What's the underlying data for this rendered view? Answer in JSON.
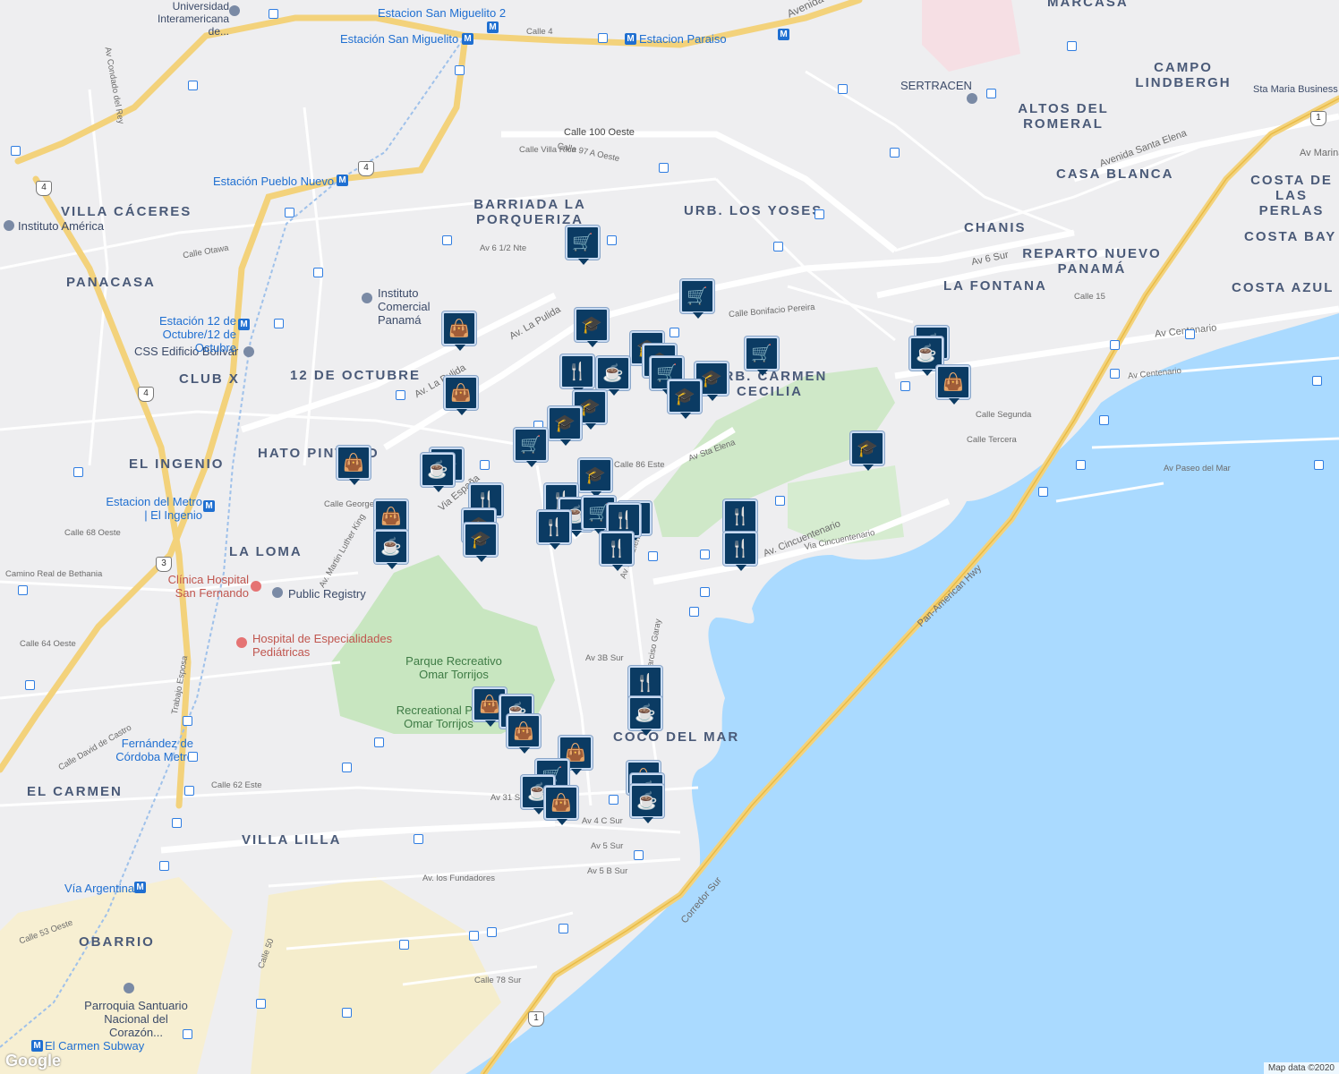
{
  "map": {
    "attribution": "Map data ©2020",
    "logo": "Google",
    "colors": {
      "water": "#aadaff",
      "land": "#eeeef0",
      "park": "#c8e6c0",
      "highway": "#f3d27b",
      "metro": "#1f6fd1",
      "marker": "#0b3b63"
    },
    "areas": [
      "VILLA CÁCERES",
      "PANACASA",
      "CLUB X",
      "12 DE OCTUBRE",
      "HATO PINTADO",
      "EL INGENIO",
      "LA LOMA",
      "EL CARMEN",
      "VILLA LILLA",
      "OBARRIO",
      "BARRIADA LA PORQUERIZA",
      "URB. LOS YOSES",
      "CAMPO LINDBERGH",
      "ALTOS DEL ROMERAL",
      "CASA BLANCA",
      "CHANIS",
      "REPARTO NUEVO PANAMÁ",
      "LA FONTANA",
      "COSTA DE LAS PERLAS",
      "COSTA BAY",
      "COSTA AZUL",
      "COCO DEL MAR",
      "MARCASA",
      "URB. CARMEN CECILIA"
    ],
    "pois": [
      "Universidad Interamericana de...",
      "Instituto América",
      "Instituto Comercial Panamá",
      "CSS Edificio Bolívar",
      "Clínica Hospital San Fernando",
      "Public Registry",
      "Hospital de Especialidades Pediátricas",
      "Parroquia Santuario Nacional del Corazón...",
      "SERTRACEN",
      "Sta Maria Business"
    ],
    "metro": [
      "Estacion San Miguelito 2",
      "Estación San Miguelito",
      "Estacion Paraiso",
      "Estación Pueblo Nuevo",
      "Estación 12 de Octubre/12 de Octubre",
      "Estacion del Metro | El Ingenio",
      "Fernández de Córdoba Metro",
      "Vía Argentina",
      "El Carmen Subway"
    ],
    "parks": [
      "Parque Recreativo Omar Torrijos",
      "Recreational P... Omar Torrijos"
    ],
    "streets": [
      "Avenida",
      "Calle 4",
      "Calle 100 Oeste",
      "Calle 97 A Oeste",
      "Calle Villa Rica",
      "Av 6 1/2 Nte",
      "Av. La Pulida",
      "Calle Otawa",
      "Via España",
      "Av Sta Elena",
      "Calle 86 Este",
      "Av. Cincuentenario",
      "Via Cincuentenario",
      "Av Centenario",
      "Av 6 Sur",
      "Avenida Santa Elena",
      "Calle Bonifacio Pereira",
      "Calle Narciso Garay",
      "Av 3B Sur",
      "Av 31 Sur",
      "Av 4 C Sur",
      "Av 5 Sur",
      "Av 5 B Sur",
      "Av. los Fundadores",
      "Calle 78 Sur",
      "Calle 62 Este",
      "Calle 64 Oeste",
      "Camino Real de Bethania",
      "Calle 68 Oeste",
      "Calle George W...",
      "Av. Martin Luther King",
      "Av Condado del Rey",
      "Calle Segunda",
      "Calle Tercera",
      "Av Paseo del Mar",
      "Calle 15",
      "Av Marina",
      "Corredor Sur",
      "Pan-American Hwy",
      "Calle David de Castro",
      "Trabajo Esposa",
      "Calle 50",
      "Calle 53 Oeste"
    ],
    "shields": [
      "1",
      "3",
      "4"
    ],
    "icons": {
      "shopping": "shopping-bag-icon",
      "restaurant": "fork-knife-icon",
      "cafe": "coffee-cup-icon",
      "school": "graduation-cap-icon",
      "grocery": "shopping-cart-icon"
    }
  }
}
